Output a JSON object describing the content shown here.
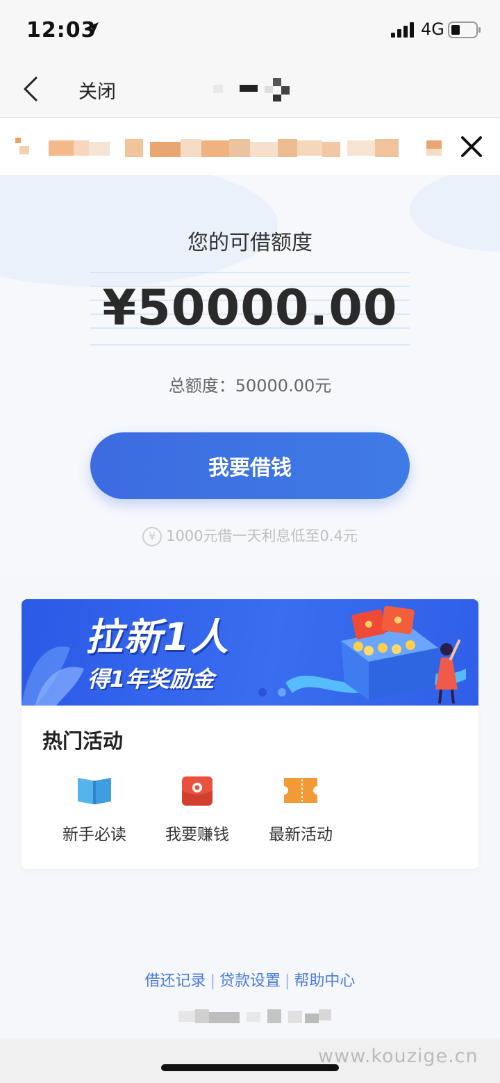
{
  "status_bar": {
    "time": "12:03",
    "network": "4G"
  },
  "nav": {
    "close_label": "关闭"
  },
  "hero": {
    "label": "您的可借额度",
    "amount": "¥50000.00",
    "total_label": "总额度：50000.00元",
    "borrow_button": "我要借钱",
    "rate_note": "1000元借一天利息低至0.4元",
    "yen_symbol": "¥"
  },
  "promo": {
    "line1": "拉新1人",
    "line2": "得1年奖励金"
  },
  "hot": {
    "title": "热门活动",
    "items": [
      {
        "label": "新手必读",
        "icon": "book-icon"
      },
      {
        "label": "我要赚钱",
        "icon": "red-envelope-icon"
      },
      {
        "label": "最新活动",
        "icon": "ticket-icon"
      }
    ]
  },
  "footer": {
    "links": [
      "借还记录",
      "贷款设置",
      "帮助中心"
    ],
    "separator": "|"
  },
  "watermark": "www.kouzige.cn",
  "colors": {
    "primary": "#3d6be0",
    "link": "#4a7be0",
    "ticket": "#f19a36",
    "envelope": "#e9513f",
    "book": "#4aa8e3"
  }
}
